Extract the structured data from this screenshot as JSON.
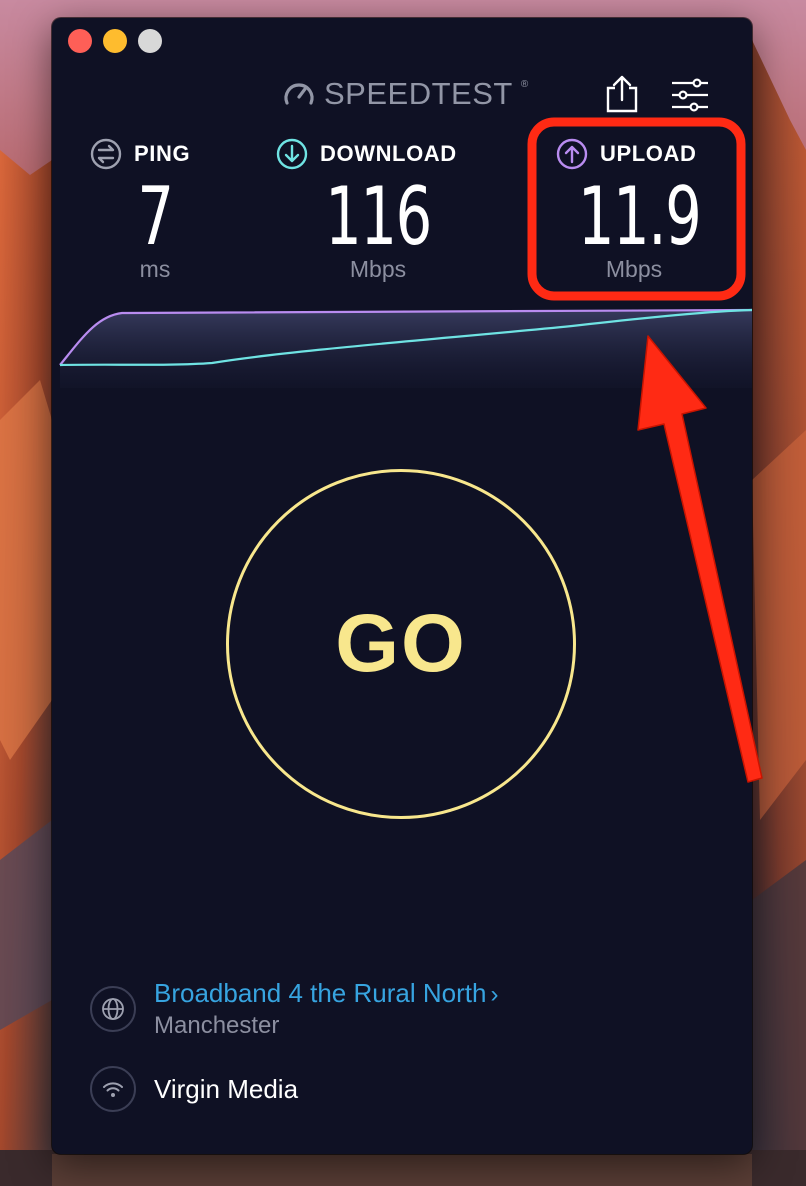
{
  "app": {
    "brand": "SPEEDTEST",
    "trademark": "®"
  },
  "metrics": {
    "ping": {
      "label": "PING",
      "value": "7",
      "unit": "ms"
    },
    "download": {
      "label": "DOWNLOAD",
      "value": "116",
      "unit": "Mbps"
    },
    "upload": {
      "label": "UPLOAD",
      "value": "11.9",
      "unit": "Mbps"
    }
  },
  "go_button": {
    "label": "GO"
  },
  "server": {
    "isp_name": "Broadband 4 the Rural North",
    "chevron": "›",
    "city": "Manchester"
  },
  "connection": {
    "provider": "Virgin Media"
  },
  "colors": {
    "window_bg": "#0f1124",
    "go_accent": "#f8e78d",
    "download_accent": "#6fe3e3",
    "upload_accent": "#b98cf0",
    "link": "#37a4e0",
    "annotation_red": "#ff2a14"
  },
  "icons": {
    "ping": "ping-icon",
    "download": "download-arrow-icon",
    "upload": "upload-arrow-icon",
    "share": "share-icon",
    "settings": "settings-sliders-icon",
    "server": "globe-icon",
    "connection": "wifi-icon"
  }
}
